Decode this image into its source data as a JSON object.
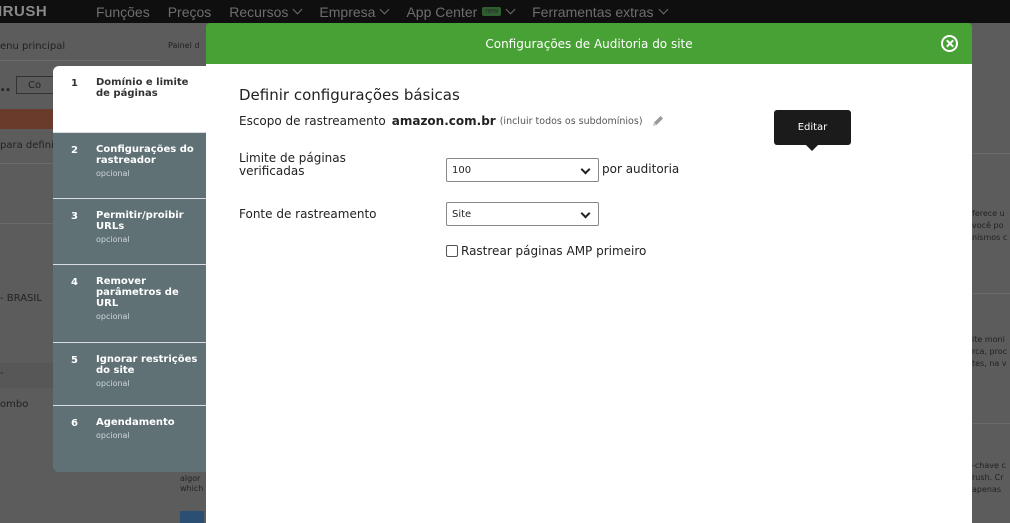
{
  "topnav": {
    "logo": "IRUSH",
    "items": [
      "Funções",
      "Preços",
      "Recursos",
      "Empresa",
      "App Center",
      "Ferramentas extras"
    ],
    "new_badge": "new"
  },
  "background": {
    "texts": [
      "enu principal",
      "Painel d",
      "..",
      "Co",
      "para defini",
      "- BRASIL",
      "-",
      "ombo",
      "algor",
      "which",
      "ferece u",
      "você po",
      "nismos c",
      "ite moni",
      "rca, proc",
      "tes, na v",
      "-chave c",
      "rush. Cr",
      "apenas"
    ]
  },
  "modal": {
    "title": "Configurações de Auditoria do site",
    "steps": [
      {
        "num": "1",
        "label": "Domínio e limite de páginas",
        "optional": ""
      },
      {
        "num": "2",
        "label": "Configurações do rastreador",
        "optional": "opcional"
      },
      {
        "num": "3",
        "label": "Permitir/proibir URLs",
        "optional": "opcional"
      },
      {
        "num": "4",
        "label": "Remover parâmetros de URL",
        "optional": "opcional"
      },
      {
        "num": "5",
        "label": "Ignorar restrições do site",
        "optional": "opcional"
      },
      {
        "num": "6",
        "label": "Agendamento",
        "optional": "opcional"
      }
    ],
    "heading": "Definir configurações básicas",
    "scope_label": "Escopo de rastreamento",
    "scope_domain": "amazon.com.br",
    "scope_hint": "(incluir todos os subdomínios)",
    "tooltip": "Editar",
    "page_limit_label": "Limite de páginas verificadas",
    "page_limit_value": "100",
    "page_limit_suffix": "por auditoria",
    "crawl_source_label": "Fonte de rastreamento",
    "crawl_source_value": "Site",
    "amp_checkbox_label": "Rastrear páginas AMP primeiro",
    "amp_checked": false
  },
  "colors": {
    "header_green": "#47a134",
    "steps_bg": "#5f7175",
    "tooltip_bg": "#1b1b1b"
  }
}
